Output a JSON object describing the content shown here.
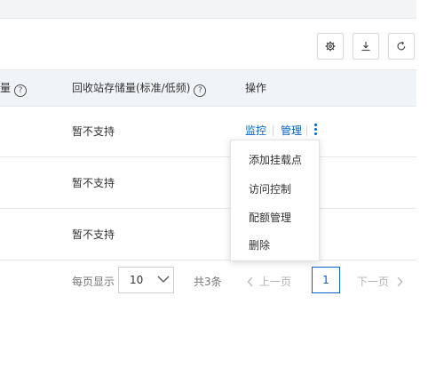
{
  "toolbar": {
    "settings_icon": "gear-icon",
    "download_icon": "download-icon",
    "refresh_icon": "refresh-icon"
  },
  "table": {
    "headers": [
      {
        "label": "量",
        "help": "?"
      },
      {
        "label": "回收站存储量(标准/低频)",
        "help": "?"
      },
      {
        "label": "操作"
      }
    ],
    "rows": [
      {
        "recycle_storage": "暂不支持",
        "actions": [
          "监控",
          "管理"
        ]
      },
      {
        "recycle_storage": "暂不支持"
      },
      {
        "recycle_storage": "暂不支持"
      }
    ]
  },
  "dropdown_menu": {
    "items": [
      "添加挂载点",
      "访问控制",
      "配额管理",
      "删除"
    ]
  },
  "pagination": {
    "per_page_label": "每页显示",
    "per_page_value": "10",
    "total_label": "共3条",
    "prev_label": "上一页",
    "next_label": "下一页",
    "current_page": "1"
  },
  "colors": {
    "link": "#0064c8",
    "header_bg": "#f0f3f7"
  }
}
